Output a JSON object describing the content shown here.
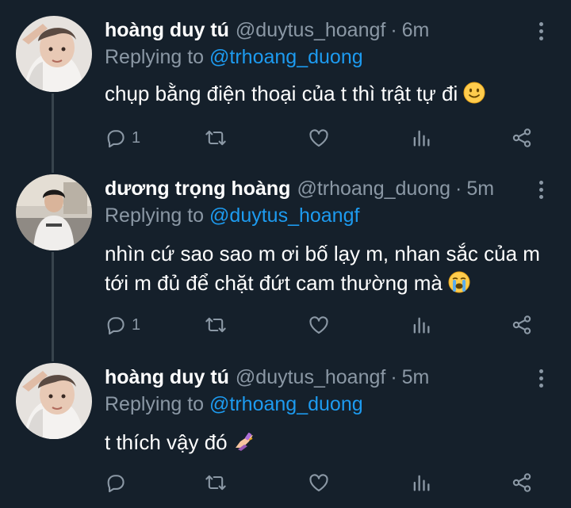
{
  "tweets": [
    {
      "name": "hoàng duy tú",
      "handle": "@duytus_hoangf",
      "separator": "·",
      "time": "6m",
      "replying_prefix": "Replying to",
      "replying_to": "@trhoang_duong",
      "text_lines": [
        "chụp bằng điện thoại của t thì trật tự đi"
      ],
      "emoji": "slightly-smiling-face",
      "reply_count": "1",
      "icons": [
        "reply-icon",
        "retweet-icon",
        "like-icon",
        "analytics-icon",
        "share-icon"
      ]
    },
    {
      "name": "dương trọng hoàng",
      "handle": "@trhoang_duong",
      "separator": "·",
      "time": "5m",
      "replying_prefix": "Replying to",
      "replying_to": "@duytus_hoangf",
      "text_lines": [
        "nhìn cứ sao sao m ơi bố lạy m, nhan sắc của m",
        "tới m đủ để chặt đứt cam thường mà"
      ],
      "emoji": "loudly-crying-face",
      "reply_count": "1",
      "icons": [
        "reply-icon",
        "retweet-icon",
        "like-icon",
        "analytics-icon",
        "share-icon"
      ]
    },
    {
      "name": "hoàng duy tú",
      "handle": "@duytus_hoangf",
      "separator": "·",
      "time": "5m",
      "replying_prefix": "Replying to",
      "replying_to": "@trhoang_duong",
      "text_lines": [
        "t thích vậy đó"
      ],
      "emoji": "nail-polish",
      "reply_count": "",
      "icons": [
        "reply-icon",
        "retweet-icon",
        "like-icon",
        "analytics-icon",
        "share-icon"
      ]
    }
  ],
  "colors": {
    "background": "#15202b",
    "secondary_text": "#8b98a5",
    "mention": "#1d9bf0",
    "thread_line": "#38444d"
  }
}
